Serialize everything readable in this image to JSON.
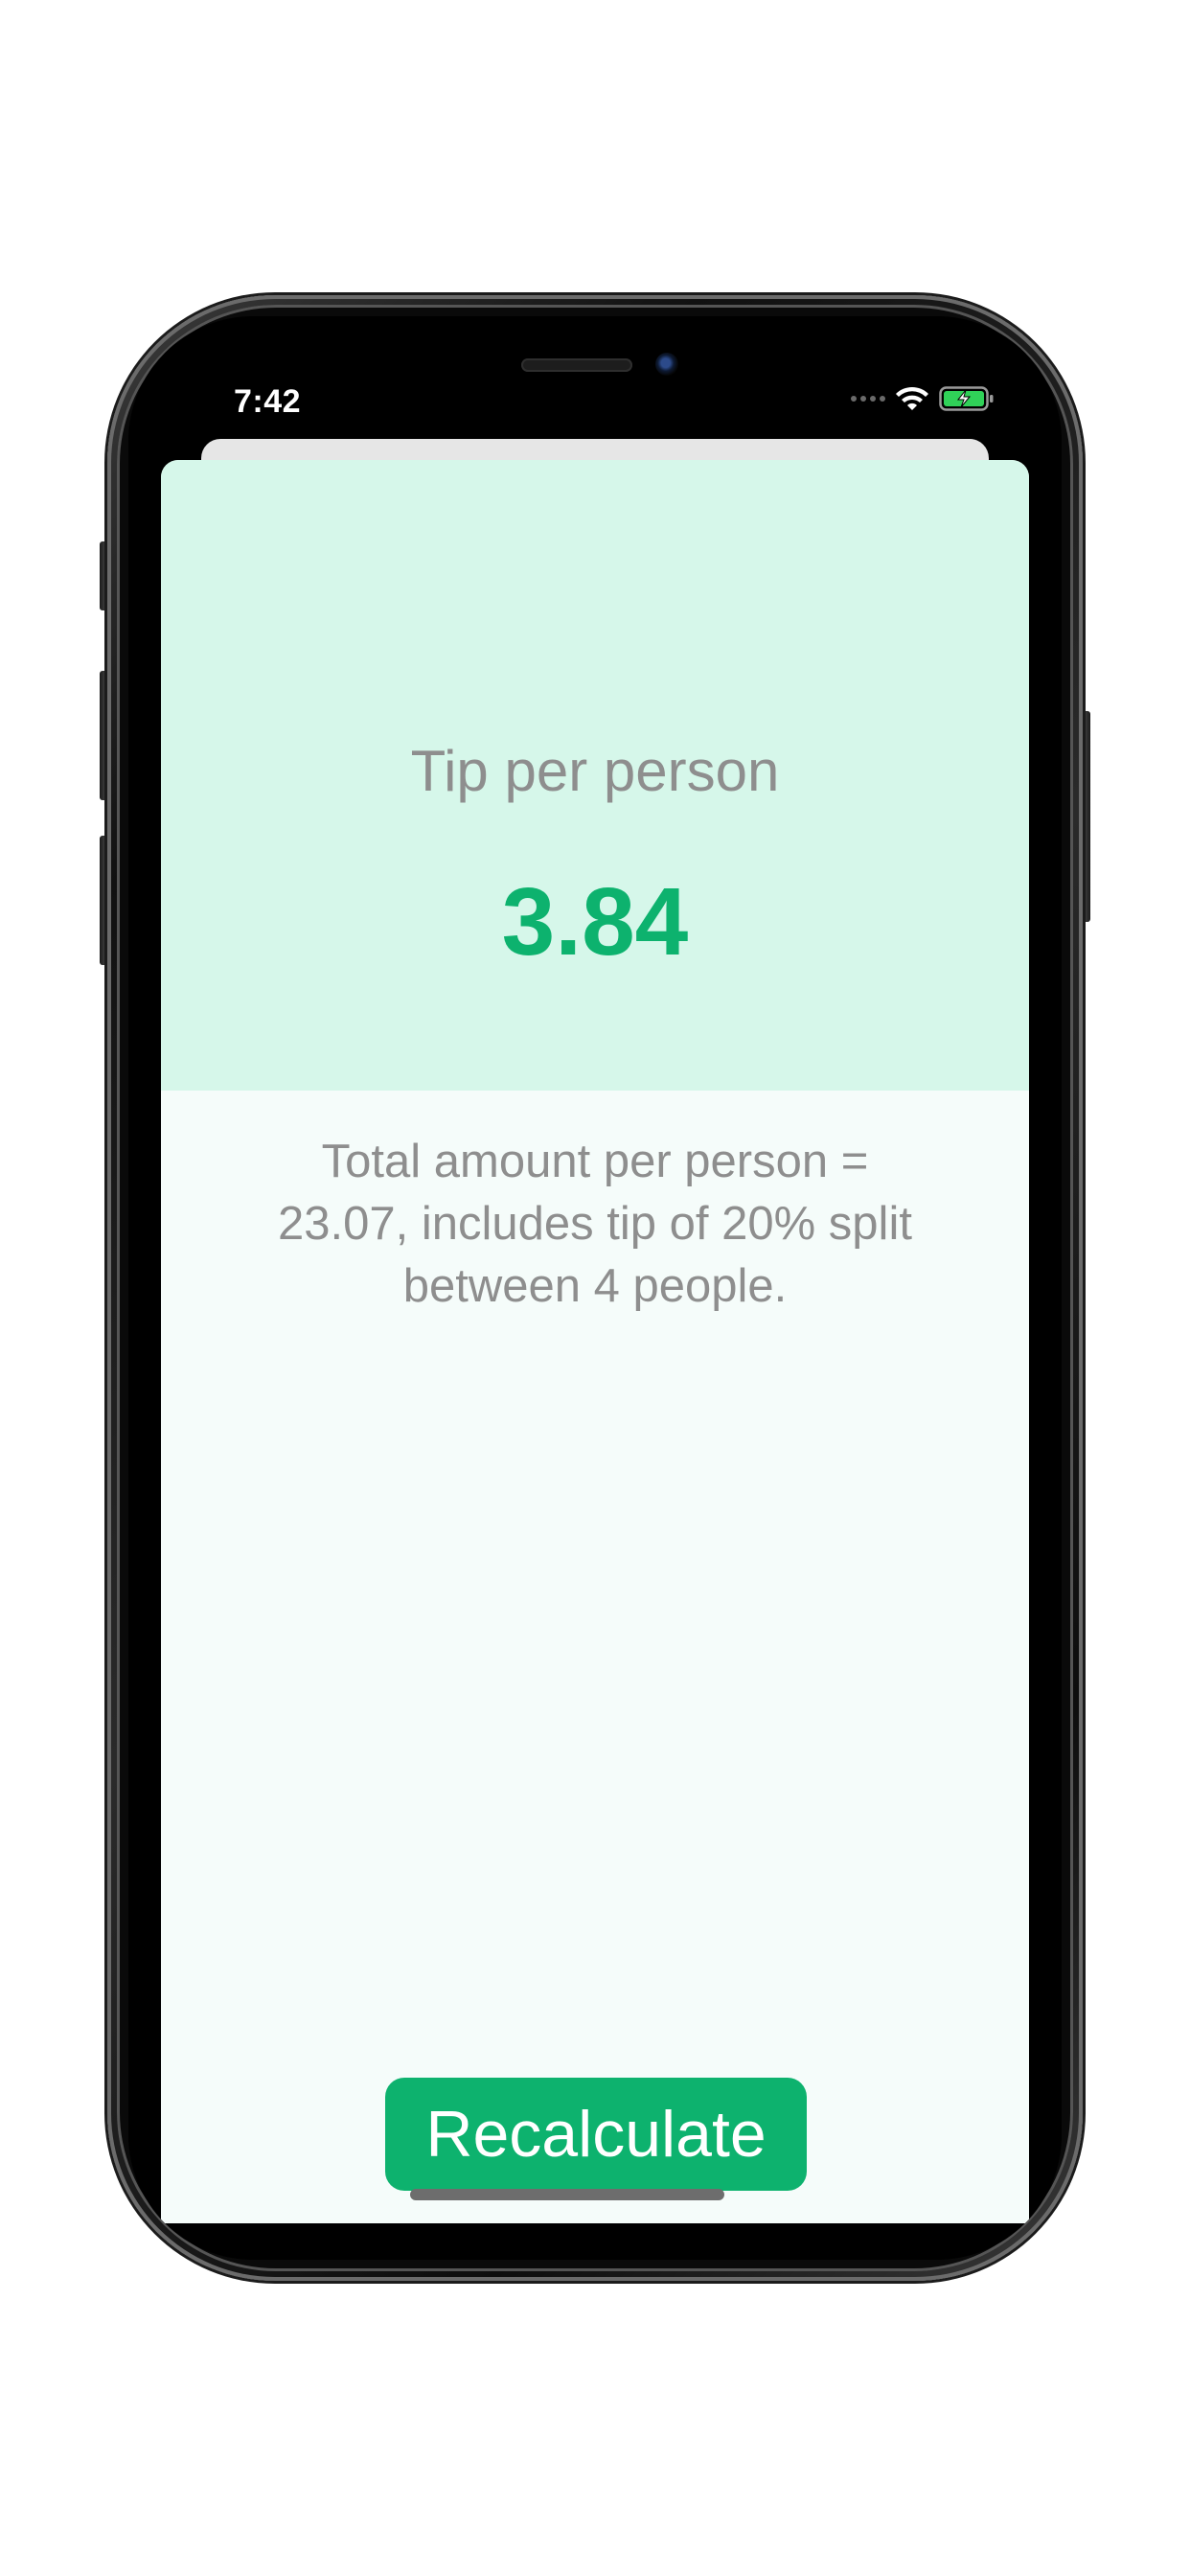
{
  "status_bar": {
    "time": "7:42",
    "wifi_icon": "wifi-icon",
    "battery_icon": "battery-charging-icon",
    "battery_color": "#30d158"
  },
  "result": {
    "tip_label": "Tip per person",
    "tip_value": "3.84",
    "summary_text": "Total amount per person = 23.07, includes tip of 20% split between 4 people."
  },
  "actions": {
    "recalculate_label": "Recalculate"
  },
  "colors": {
    "accent": "#0db26e",
    "header_background": "#d6f7ea",
    "body_background": "#f5fcfa",
    "secondary_text": "#8e8e8e"
  }
}
